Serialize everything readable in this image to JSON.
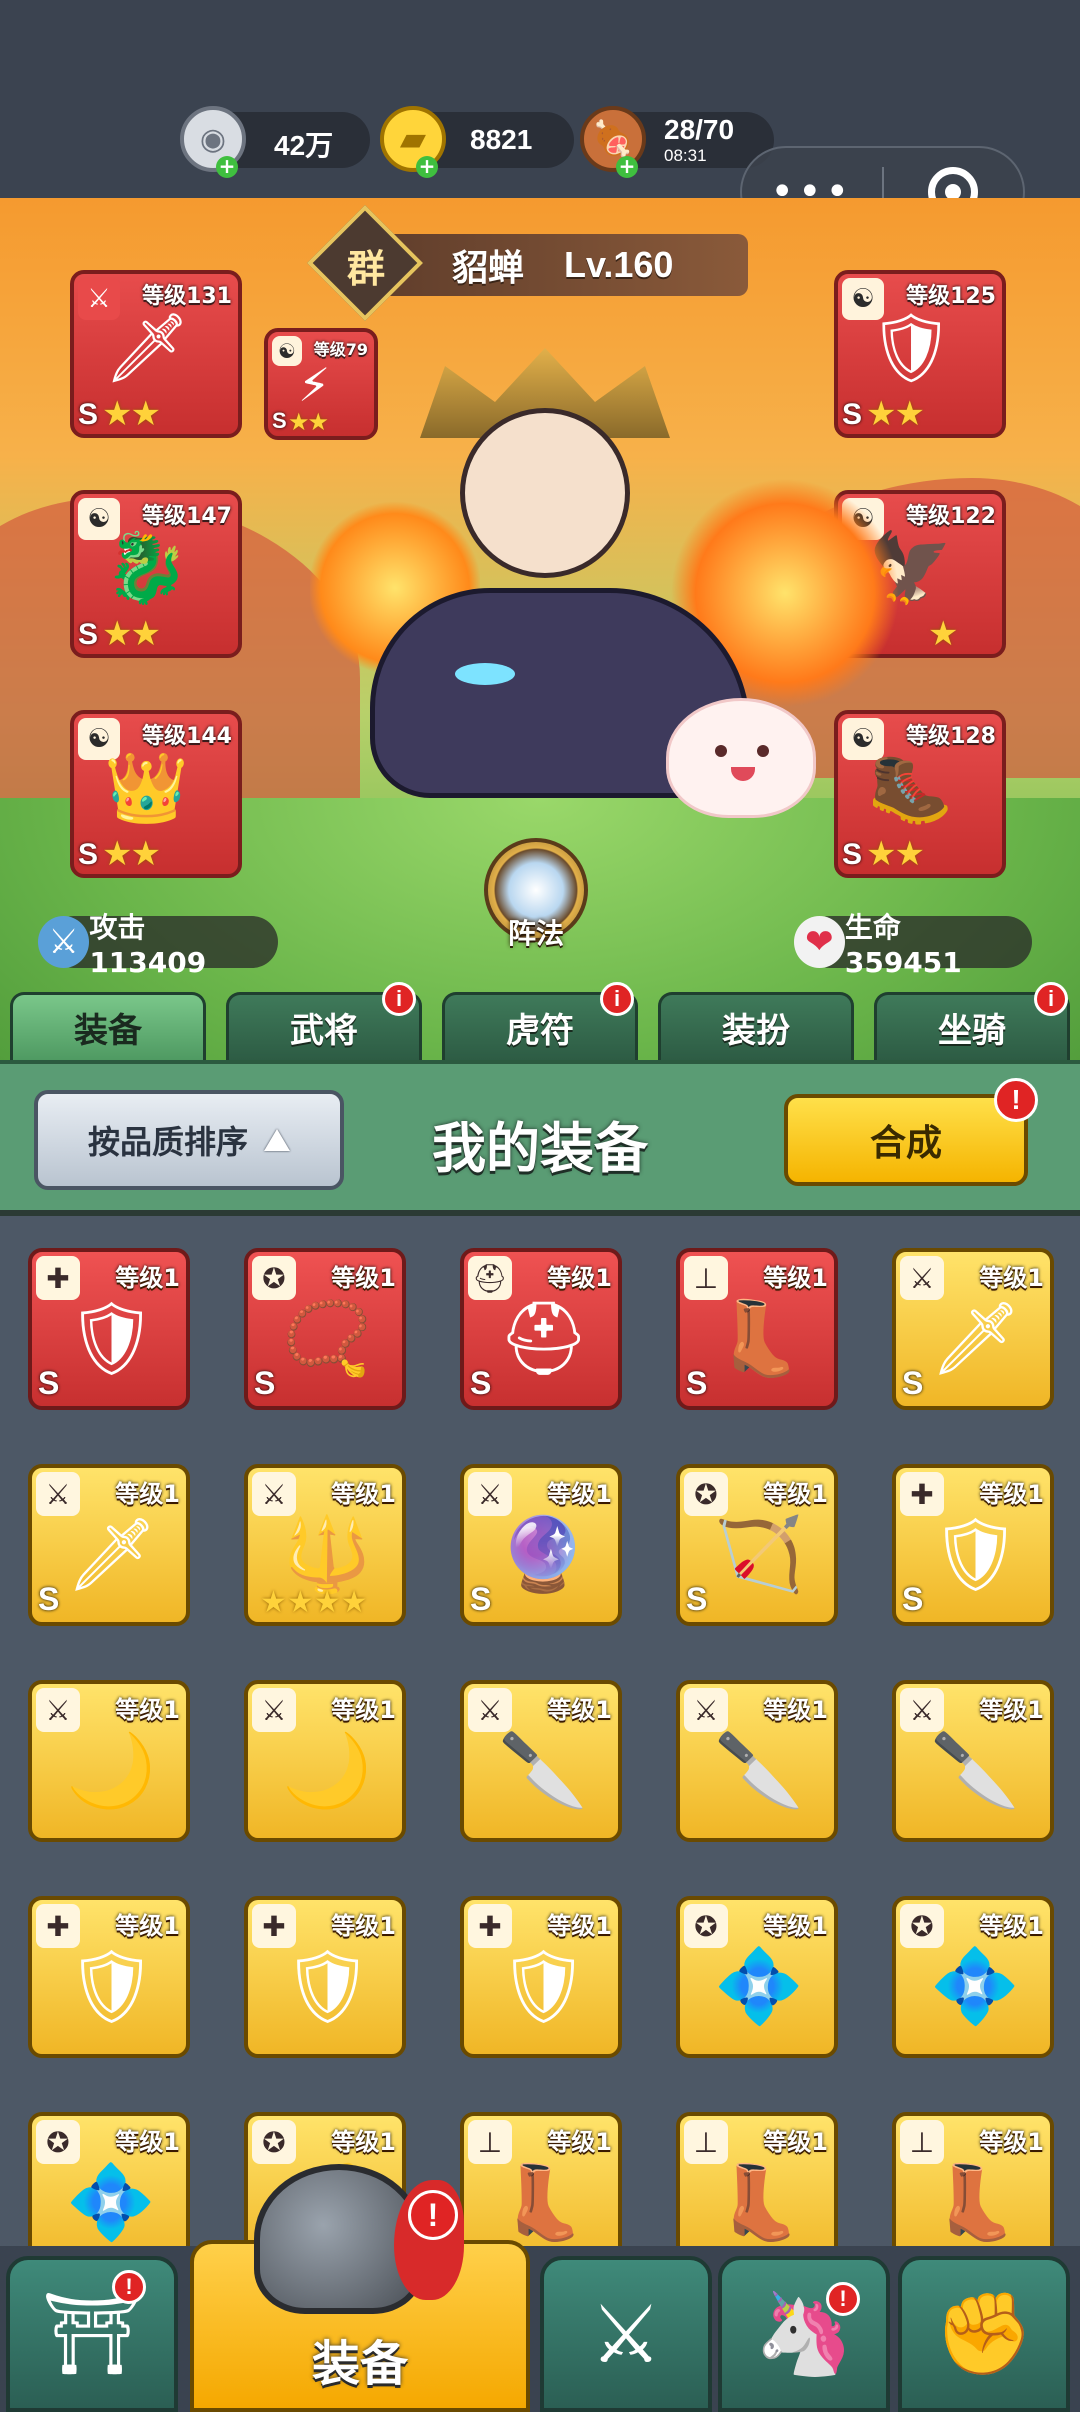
{
  "resources": [
    {
      "name": "silver-coin",
      "value": "42万",
      "sub": ""
    },
    {
      "name": "gold-ingot",
      "value": "8821",
      "sub": ""
    },
    {
      "name": "meat-stamina",
      "value": "28/70",
      "sub": "08:31"
    }
  ],
  "capsule": {
    "more": "•••",
    "close": "target"
  },
  "hero": {
    "faction": "群",
    "name": "貂蝉",
    "level": "Lv.160"
  },
  "equipped_left": [
    {
      "level": "等级131",
      "grade": "S",
      "stars": "★★",
      "badge": "⚔",
      "icon": "spear-weapon-icon"
    },
    {
      "level": "等级79",
      "grade": "S",
      "stars": "★★",
      "badge": "☯",
      "icon": "lightning-sword-icon"
    },
    {
      "level": "等级147",
      "grade": "S",
      "stars": "★★",
      "badge": "☯",
      "icon": "ice-dragon-icon"
    },
    {
      "level": "等级144",
      "grade": "S",
      "stars": "★★",
      "badge": "☯",
      "icon": "ice-crown-icon"
    }
  ],
  "equipped_right": [
    {
      "level": "等级125",
      "grade": "S",
      "stars": "★★",
      "badge": "☯",
      "icon": "ice-armor-icon"
    },
    {
      "level": "等级122",
      "grade": "S",
      "stars": "★",
      "badge": "☯",
      "icon": "ice-claw-icon"
    },
    {
      "level": "等级128",
      "grade": "S",
      "stars": "★★",
      "badge": "☯",
      "icon": "ice-boot-icon"
    }
  ],
  "formation_label": "阵法",
  "stats": {
    "attack": "攻击113409",
    "hp": "生命359451"
  },
  "tabs": [
    {
      "label": "装备",
      "active": true,
      "badge": ""
    },
    {
      "label": "武将",
      "active": false,
      "badge": "i"
    },
    {
      "label": "虎符",
      "active": false,
      "badge": "i"
    },
    {
      "label": "装扮",
      "active": false,
      "badge": ""
    },
    {
      "label": "坐骑",
      "active": false,
      "badge": "i"
    }
  ],
  "panel": {
    "sort_label": "按品质排序",
    "title": "我的装备",
    "merge_label": "合成",
    "merge_badge": "!"
  },
  "items": [
    {
      "level": "等级1",
      "color": "red",
      "badge": "✚",
      "icon": "armor-icon",
      "grade": "S",
      "stars": ""
    },
    {
      "level": "等级1",
      "color": "red",
      "badge": "✪",
      "icon": "amulet-icon",
      "grade": "S",
      "stars": ""
    },
    {
      "level": "等级1",
      "color": "red",
      "badge": "⛑",
      "icon": "helmet-icon",
      "grade": "S",
      "stars": ""
    },
    {
      "level": "等级1",
      "color": "red",
      "badge": "⊥",
      "icon": "boot-icon",
      "grade": "S",
      "stars": ""
    },
    {
      "level": "等级1",
      "color": "gold",
      "badge": "⚔",
      "icon": "scimitar-icon",
      "grade": "S",
      "stars": ""
    },
    {
      "level": "等级1",
      "color": "gold",
      "badge": "⚔",
      "icon": "scimitar-icon",
      "grade": "S",
      "stars": ""
    },
    {
      "level": "等级1",
      "color": "gold",
      "badge": "⚔",
      "icon": "spear-icon",
      "grade": "",
      "stars": "★★★★"
    },
    {
      "level": "等级1",
      "color": "gold",
      "badge": "⚔",
      "icon": "orb-weapon-icon",
      "grade": "S",
      "stars": ""
    },
    {
      "level": "等级1",
      "color": "gold",
      "badge": "✪",
      "icon": "bow-icon",
      "grade": "S",
      "stars": ""
    },
    {
      "level": "等级1",
      "color": "gold",
      "badge": "✚",
      "icon": "armor-icon",
      "grade": "S",
      "stars": ""
    },
    {
      "level": "等级1",
      "color": "gold",
      "badge": "⚔",
      "icon": "curved-blade-icon",
      "grade": "",
      "stars": ""
    },
    {
      "level": "等级1",
      "color": "gold",
      "badge": "⚔",
      "icon": "curved-blade-icon",
      "grade": "",
      "stars": ""
    },
    {
      "level": "等级1",
      "color": "gold",
      "badge": "⚔",
      "icon": "broadsword-icon",
      "grade": "",
      "stars": ""
    },
    {
      "level": "等级1",
      "color": "gold",
      "badge": "⚔",
      "icon": "broadsword-icon",
      "grade": "",
      "stars": ""
    },
    {
      "level": "等级1",
      "color": "gold",
      "badge": "⚔",
      "icon": "broadsword-icon",
      "grade": "",
      "stars": ""
    },
    {
      "level": "等级1",
      "color": "gold",
      "badge": "✚",
      "icon": "armor-icon",
      "grade": "",
      "stars": ""
    },
    {
      "level": "等级1",
      "color": "gold",
      "badge": "✚",
      "icon": "armor-icon",
      "grade": "",
      "stars": ""
    },
    {
      "level": "等级1",
      "color": "gold",
      "badge": "✚",
      "icon": "armor-icon",
      "grade": "",
      "stars": ""
    },
    {
      "level": "等级1",
      "color": "gold",
      "badge": "✪",
      "icon": "jade-pendant-icon",
      "grade": "",
      "stars": ""
    },
    {
      "level": "等级1",
      "color": "gold",
      "badge": "✪",
      "icon": "jade-pendant-icon",
      "grade": "",
      "stars": ""
    },
    {
      "level": "等级1",
      "color": "gold",
      "badge": "✪",
      "icon": "jade-pendant-icon",
      "grade": "",
      "stars": ""
    },
    {
      "level": "等级1",
      "color": "gold",
      "badge": "✪",
      "icon": "coin-pouch-icon",
      "grade": "",
      "stars": ""
    },
    {
      "level": "等级1",
      "color": "gold",
      "badge": "⊥",
      "icon": "boot-icon",
      "grade": "",
      "stars": ""
    },
    {
      "level": "等级1",
      "color": "gold",
      "badge": "⊥",
      "icon": "boot-icon",
      "grade": "",
      "stars": ""
    },
    {
      "level": "等级1",
      "color": "gold",
      "badge": "⊥",
      "icon": "boot-icon",
      "grade": "",
      "stars": ""
    }
  ],
  "bottom_nav": [
    {
      "name": "nav-shop",
      "label": "",
      "badge": "!",
      "icon": "shop-gate-icon"
    },
    {
      "name": "nav-equipment",
      "label": "装备",
      "badge": "!",
      "icon": "helmet-icon"
    },
    {
      "name": "nav-battle",
      "label": "",
      "badge": "",
      "icon": "crossed-swords-icon"
    },
    {
      "name": "nav-pets",
      "label": "",
      "badge": "!",
      "icon": "beast-icon"
    },
    {
      "name": "nav-upgrade",
      "label": "",
      "badge": "",
      "icon": "fist-upgrade-icon"
    }
  ]
}
